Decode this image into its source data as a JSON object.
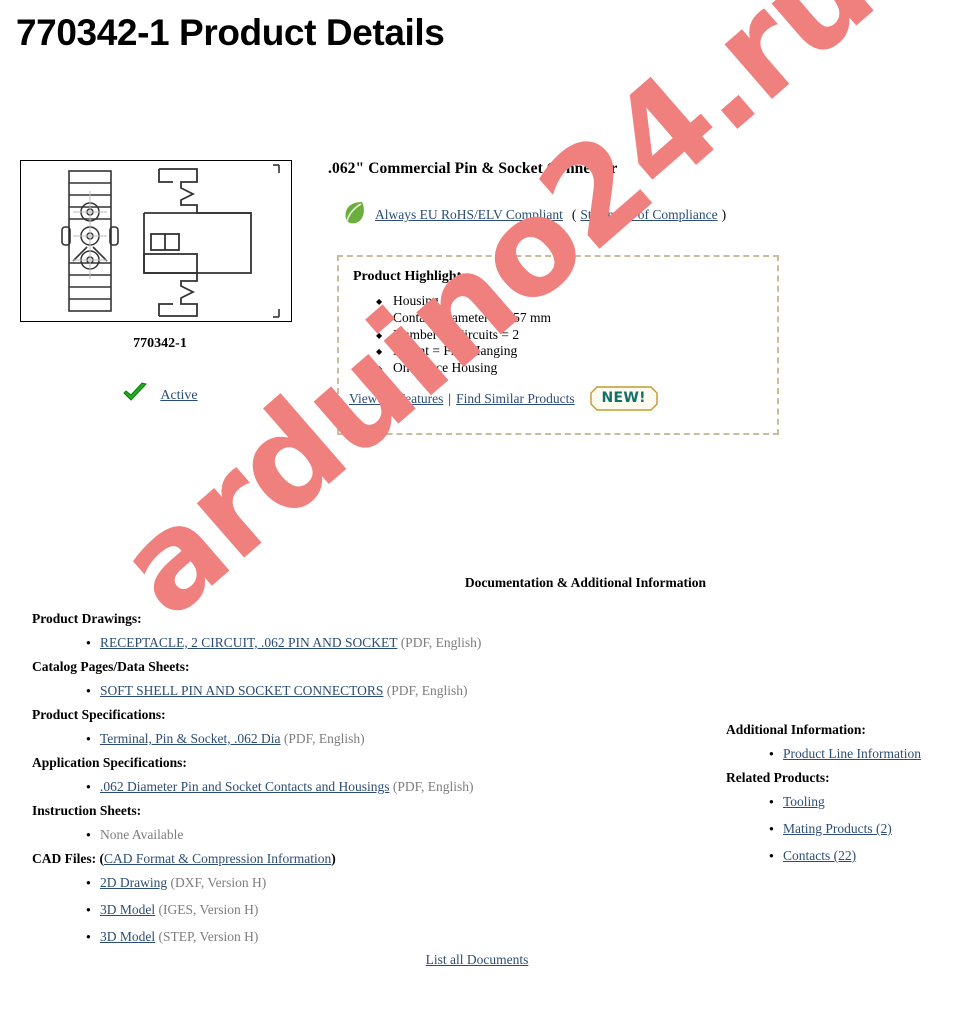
{
  "page": {
    "title": "770342-1 Product Details"
  },
  "product_image": {
    "caption": "770342-1",
    "alt": "product-line-drawing"
  },
  "status": {
    "icon": "green-check-icon",
    "label": "Active"
  },
  "detail": {
    "product_name": ".062\" Commercial Pin & Socket Connector",
    "rohs": {
      "icon": "green-leaf-icon",
      "link_label": "Always EU RoHS/ELV Compliant",
      "open_paren": "(",
      "statement_label": "Statement of Compliance",
      "close_paren": ")"
    }
  },
  "highlights": {
    "title": "Product Highlights:",
    "items": [
      "Housing",
      "Contact Diameter = 1.57 mm",
      "Number of Circuits = 2",
      "Mount = Free Hanging",
      "One Piece Housing"
    ],
    "view_all_label": "View all Features",
    "separator": "|",
    "find_similar_label": "Find Similar Products",
    "new_badge_label": "NEW!"
  },
  "documentation": {
    "heading": "Documentation & Additional Information",
    "groups": [
      {
        "title": "Product Drawings:",
        "items": [
          {
            "link": "RECEPTACLE, 2 CIRCUIT, .062 PIN AND SOCKET",
            "meta": " (PDF, English)"
          }
        ]
      },
      {
        "title": "Catalog Pages/Data Sheets:",
        "items": [
          {
            "link": "SOFT SHELL PIN AND SOCKET CONNECTORS",
            "meta": " (PDF, English)"
          }
        ]
      },
      {
        "title": "Product Specifications:",
        "items": [
          {
            "link": "Terminal, Pin & Socket, .062 Dia",
            "meta": " (PDF, English)"
          }
        ]
      },
      {
        "title": "Application Specifications:",
        "items": [
          {
            "link": ".062 Diameter Pin and Socket Contacts and Housings",
            "meta": " (PDF, English)"
          }
        ]
      },
      {
        "title": "Instruction Sheets:",
        "items": [
          {
            "none": "None Available"
          }
        ]
      }
    ],
    "cad": {
      "title": "CAD Files:",
      "open_paren": "(",
      "format_link": "CAD Format & Compression Information",
      "close_paren": ")",
      "items": [
        {
          "link": "2D Drawing",
          "meta": " (DXF, Version H)"
        },
        {
          "link": "3D Model",
          "meta": " (IGES, Version H)"
        },
        {
          "link": "3D Model",
          "meta": " (STEP, Version H)"
        }
      ]
    }
  },
  "additional": {
    "title": "Additional Information:",
    "items": [
      {
        "link": "Product Line Information"
      }
    ]
  },
  "related": {
    "title": "Related Products:",
    "items": [
      {
        "link": "Tooling"
      },
      {
        "link": "Mating Products (2)"
      },
      {
        "link": "Contacts (22)"
      }
    ]
  },
  "footer": {
    "list_all_label": "List all Documents"
  },
  "watermark": {
    "text": "arduino24.ru",
    "color": "#f0807e"
  },
  "colors": {
    "link": "#2b4d75",
    "meta_gray": "#7d7d7d",
    "highlight_border": "#cbbd9b",
    "badge_text": "#12706b",
    "badge_border": "#c49a2f",
    "leaf_green": "#6cae3c",
    "check_green": "#1d9c1d"
  }
}
